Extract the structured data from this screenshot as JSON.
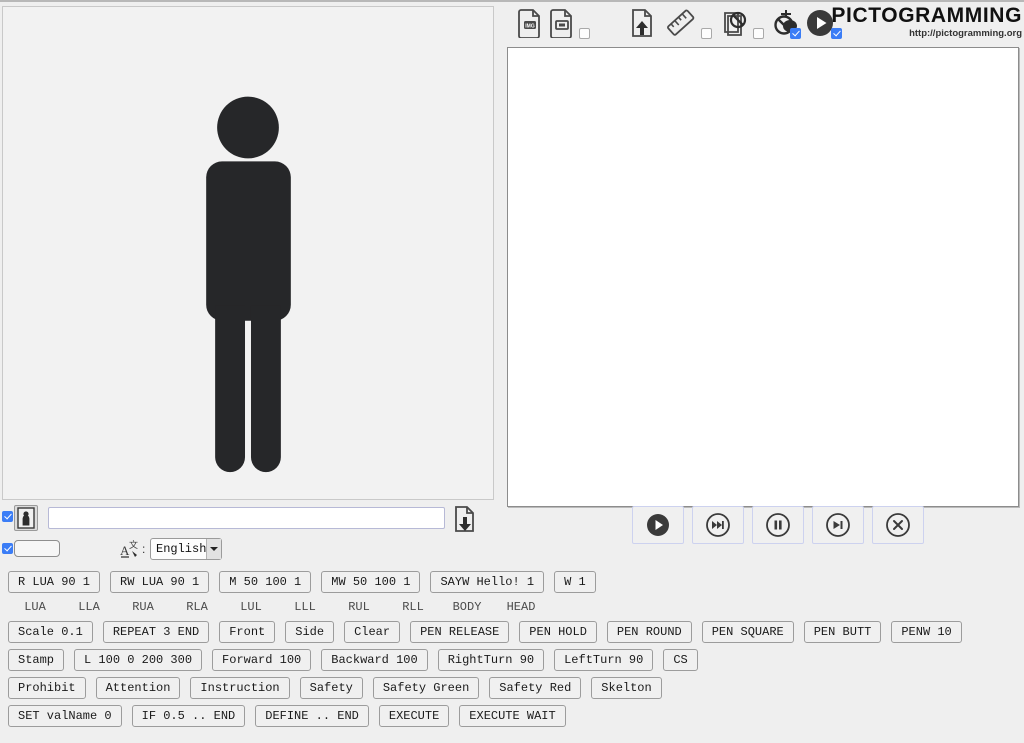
{
  "brand": {
    "name": "PICTOGRAMMING",
    "url": "http://pictogramming.org"
  },
  "editor_toolbar": {
    "icons": [
      {
        "name": "save-image-icon",
        "label": "IMG"
      },
      {
        "name": "save-animation-icon",
        "label": ""
      },
      {
        "name": "load-file-icon",
        "label": ""
      },
      {
        "name": "ruler-icon",
        "label": ""
      },
      {
        "name": "no-grid-icon",
        "label": ""
      },
      {
        "name": "no-guide-icon",
        "label": ""
      },
      {
        "name": "play-filled-icon",
        "label": ""
      }
    ],
    "checkboxes": [
      {
        "name": "toolbar-checkbox-1",
        "checked": false
      },
      {
        "name": "toolbar-checkbox-2",
        "checked": false
      },
      {
        "name": "toolbar-checkbox-3",
        "checked": false
      },
      {
        "name": "toolbar-checkbox-4",
        "checked": true
      },
      {
        "name": "toolbar-checkbox-5",
        "checked": true
      }
    ]
  },
  "code_editor": {
    "value": "",
    "placeholder": ""
  },
  "playback": {
    "buttons": [
      {
        "name": "play-button",
        "icon": "play"
      },
      {
        "name": "fast-forward-button",
        "icon": "fast-forward"
      },
      {
        "name": "pause-button",
        "icon": "pause"
      },
      {
        "name": "step-button",
        "icon": "step"
      },
      {
        "name": "stop-button",
        "icon": "stop"
      }
    ]
  },
  "input_row": {
    "checkbox_checked": true,
    "person_button": "pictogram-person-icon",
    "command_value": "",
    "command_placeholder": "",
    "download_button": "file-download-icon"
  },
  "lang_row": {
    "checkbox_checked": true,
    "small_input_value": "",
    "translate_icon": "translate-icon",
    "separator": ":",
    "language": "English"
  },
  "command_rows": [
    {
      "name": "motion-commands",
      "buttons": [
        "R LUA 90 1",
        "RW LUA 90 1",
        "M 50 100 1",
        "MW 50 100 1",
        "SAYW Hello! 1",
        "W 1"
      ]
    },
    {
      "name": "drawing-commands",
      "buttons": [
        "Scale  0.1",
        "REPEAT 3 END",
        "Front",
        "Side",
        "Clear",
        "PEN RELEASE",
        "PEN HOLD",
        "PEN ROUND",
        "PEN SQUARE",
        "PEN BUTT",
        "PENW 10"
      ]
    },
    {
      "name": "turtle-commands",
      "buttons": [
        "Stamp",
        "L 100 0 200 300",
        "Forward 100",
        "Backward 100",
        "RightTurn 90",
        "LeftTurn 90",
        "CS"
      ]
    },
    {
      "name": "sign-commands",
      "buttons": [
        "Prohibit",
        "Attention",
        "Instruction",
        "Safety",
        "Safety Green",
        "Safety Red",
        "Skelton"
      ]
    },
    {
      "name": "program-commands",
      "buttons": [
        "SET valName 0",
        "IF 0.5 .. END",
        "DEFINE .. END",
        "EXECUTE",
        "EXECUTE WAIT"
      ]
    }
  ],
  "body_parts": [
    "LUA",
    "LLA",
    "RUA",
    "RLA",
    "LUL",
    "LLL",
    "RUL",
    "RLL",
    "BODY",
    "HEAD"
  ],
  "colors": {
    "pictogram": "#262729",
    "canvas_bg": "#f2f2f2",
    "page_bg": "#efefef",
    "accent_checkbox": "#3b7df6",
    "editor_bg": "#ffffff"
  }
}
